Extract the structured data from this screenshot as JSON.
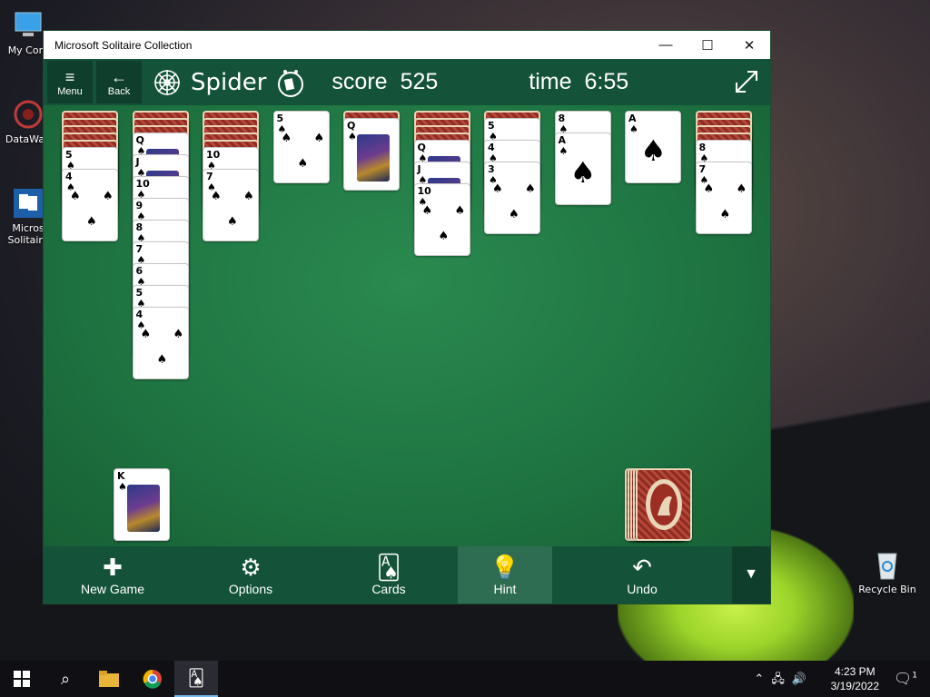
{
  "desktop": {
    "icons": [
      {
        "label": "My Com"
      },
      {
        "label": "DataWag"
      },
      {
        "label": "Micros Solitaire"
      },
      {
        "label": "Recycle Bin"
      }
    ]
  },
  "window": {
    "title": "Microsoft Solitaire Collection",
    "controls": {
      "minimize": "—",
      "maximize": "☐",
      "close": "✕"
    }
  },
  "header": {
    "menu_label": "Menu",
    "back_label": "Back",
    "game_title": "Spider",
    "score_label": "score",
    "score_value": "525",
    "time_label": "time",
    "time_value": "6:55"
  },
  "tableau": {
    "columns": [
      {
        "hidden": 5,
        "cards": [
          "5",
          "4"
        ],
        "bottom": "4"
      },
      {
        "hidden": 3,
        "cards": [
          "Q",
          "J",
          "10",
          "9",
          "8",
          "7",
          "6",
          "5",
          "4"
        ],
        "bottom": "4"
      },
      {
        "hidden": 5,
        "cards": [
          "10",
          "7"
        ],
        "bottom": "7"
      },
      {
        "hidden": 0,
        "cards": [
          "5"
        ],
        "bottom": "5"
      },
      {
        "hidden": 1,
        "cards": [
          "Q"
        ],
        "bottom": "Q"
      },
      {
        "hidden": 4,
        "cards": [
          "Q",
          "J",
          "10"
        ],
        "bottom": "10"
      },
      {
        "hidden": 1,
        "cards": [
          "5",
          "4",
          "3"
        ],
        "bottom": "3"
      },
      {
        "hidden": 0,
        "cards": [
          "8",
          "A"
        ],
        "bottom": "A"
      },
      {
        "hidden": 0,
        "cards": [
          "A"
        ],
        "bottom": "A"
      },
      {
        "hidden": 4,
        "cards": [
          "8",
          "7"
        ],
        "bottom": "7"
      }
    ],
    "suit_glyph": "♠"
  },
  "foundation": {
    "completed_top": "K"
  },
  "toolbar": {
    "new_game": "New Game",
    "options": "Options",
    "cards": "Cards",
    "hint": "Hint",
    "undo": "Undo"
  },
  "taskbar": {
    "time": "4:23 PM",
    "date": "3/19/2022",
    "notification_count": "1"
  }
}
